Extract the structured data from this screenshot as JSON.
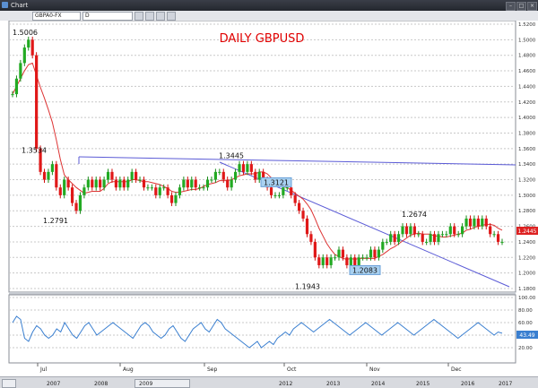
{
  "window": {
    "title": "Chart",
    "symbol": "GBPA0-FX",
    "interval": "D"
  },
  "chart_data": {
    "type": "candlestick",
    "title": "DAILY GBPUSD",
    "ylim": [
      1.18,
      1.52
    ],
    "yticks": [
      "1.5200",
      "1.5000",
      "1.4800",
      "1.4600",
      "1.4400",
      "1.4200",
      "1.4000",
      "1.3800",
      "1.3600",
      "1.3400",
      "1.3200",
      "1.3000",
      "1.2800",
      "1.2600",
      "1.2400",
      "1.2200",
      "1.2000",
      "1.1800"
    ],
    "xticks": [
      "Jul",
      "Aug",
      "Sep",
      "Oct",
      "Nov",
      "Dec"
    ],
    "current_price": "1.2445",
    "annotations": [
      {
        "text": "1.5006",
        "value": 1.5006
      },
      {
        "text": "1.3534",
        "value": 1.3534
      },
      {
        "text": "1.2791",
        "value": 1.2791
      },
      {
        "text": "1.3445",
        "value": 1.3445
      },
      {
        "text": "1.3121",
        "value": 1.3121,
        "boxed": true
      },
      {
        "text": "1.1943",
        "value": 1.1943
      },
      {
        "text": "1.2083",
        "value": 1.2083,
        "boxed": true
      },
      {
        "text": "1.2674",
        "value": 1.2674
      }
    ],
    "series": [
      {
        "name": "price",
        "closes": [
          1.43,
          1.45,
          1.47,
          1.49,
          1.5,
          1.48,
          1.36,
          1.33,
          1.32,
          1.33,
          1.34,
          1.31,
          1.3,
          1.32,
          1.31,
          1.29,
          1.28,
          1.3,
          1.31,
          1.32,
          1.31,
          1.32,
          1.31,
          1.32,
          1.33,
          1.32,
          1.31,
          1.32,
          1.31,
          1.32,
          1.33,
          1.32,
          1.32,
          1.31,
          1.31,
          1.31,
          1.3,
          1.31,
          1.31,
          1.3,
          1.29,
          1.3,
          1.31,
          1.32,
          1.31,
          1.32,
          1.31,
          1.31,
          1.31,
          1.32,
          1.32,
          1.33,
          1.33,
          1.32,
          1.31,
          1.32,
          1.33,
          1.34,
          1.33,
          1.34,
          1.33,
          1.32,
          1.33,
          1.32,
          1.31,
          1.3,
          1.3,
          1.3,
          1.31,
          1.31,
          1.3,
          1.29,
          1.28,
          1.27,
          1.25,
          1.24,
          1.22,
          1.21,
          1.22,
          1.21,
          1.22,
          1.22,
          1.23,
          1.22,
          1.21,
          1.22,
          1.21,
          1.22,
          1.22,
          1.22,
          1.23,
          1.22,
          1.23,
          1.24,
          1.24,
          1.25,
          1.24,
          1.25,
          1.26,
          1.25,
          1.26,
          1.25,
          1.25,
          1.24,
          1.24,
          1.25,
          1.24,
          1.25,
          1.25,
          1.25,
          1.26,
          1.25,
          1.25,
          1.26,
          1.27,
          1.26,
          1.27,
          1.26,
          1.27,
          1.26,
          1.25,
          1.25,
          1.24,
          1.24
        ]
      }
    ],
    "oscillator": {
      "ylim": [
        0,
        100
      ],
      "yticks": [
        "100.00",
        "80.00",
        "60.00",
        "40.00",
        "20.00"
      ],
      "current": "43.49",
      "values": [
        60,
        70,
        65,
        35,
        30,
        45,
        55,
        50,
        40,
        35,
        40,
        50,
        45,
        60,
        50,
        40,
        35,
        45,
        55,
        60,
        50,
        40,
        45,
        50,
        55,
        60,
        55,
        50,
        45,
        40,
        35,
        45,
        55,
        60,
        55,
        45,
        40,
        35,
        40,
        50,
        55,
        45,
        35,
        30,
        40,
        50,
        55,
        60,
        50,
        45,
        55,
        65,
        60,
        50,
        45,
        40,
        35,
        30,
        25,
        20,
        25,
        30,
        20,
        25,
        30,
        25,
        35,
        40,
        45,
        40,
        50,
        55,
        60,
        55,
        50,
        45,
        50,
        55,
        60,
        65,
        60,
        55,
        50,
        45,
        40,
        45,
        50,
        55,
        60,
        55,
        50,
        45,
        40,
        45,
        50,
        55,
        60,
        55,
        50,
        45,
        40,
        45,
        50,
        55,
        60,
        65,
        60,
        55,
        50,
        45,
        40,
        35,
        40,
        45,
        50,
        55,
        60,
        55,
        50,
        45,
        40,
        45,
        43
      ]
    },
    "years": [
      "2007",
      "2008",
      "2009",
      "2012",
      "2013",
      "2014",
      "2015",
      "2016",
      "2017"
    ]
  }
}
